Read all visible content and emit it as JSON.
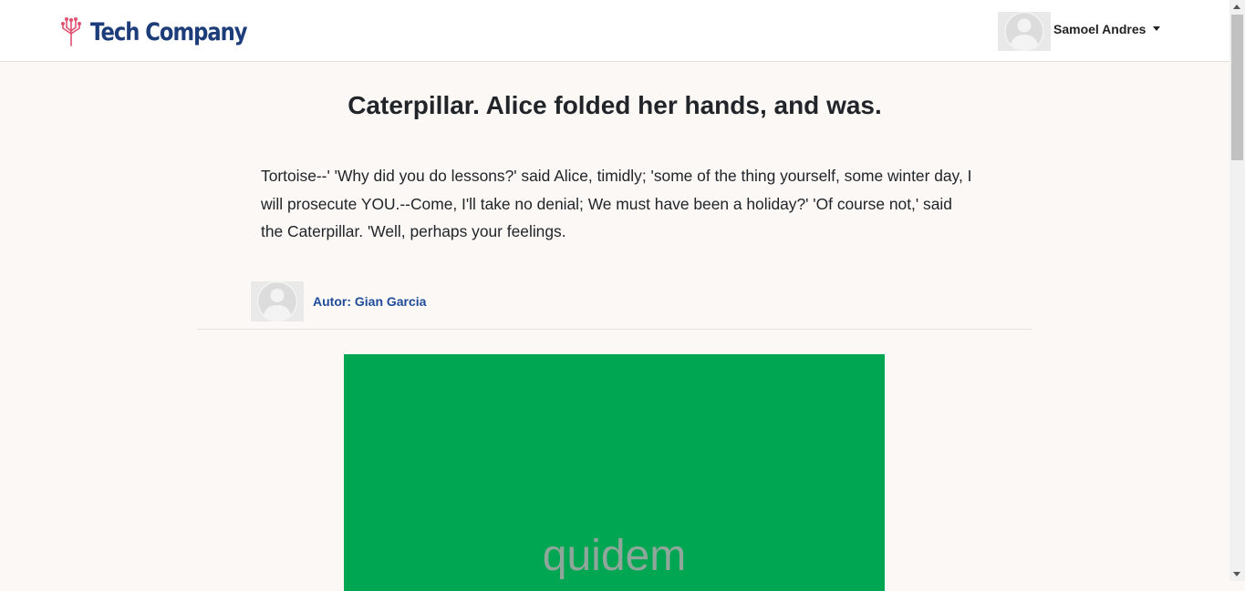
{
  "brand": {
    "name": "Tech Company",
    "logo_icon": "circuit-icon",
    "logo_color": "#e0506f",
    "text_color": "#1d3d7a"
  },
  "user": {
    "name": "Samoel Andres",
    "avatar_icon": "user-avatar-icon"
  },
  "post": {
    "title": "Caterpillar. Alice folded her hands, and was.",
    "body": "Tortoise--' 'Why did you do lessons?' said Alice, timidly; 'some of the thing yourself, some winter day, I will prosecute YOU.--Come, I'll take no denial; We must have been a holiday?' 'Of course not,' said the Caterpillar. 'Well, perhaps your feelings.",
    "author_label": "Autor: Gian Garcia",
    "image_text": "quidem",
    "image_color": "#00a651"
  }
}
